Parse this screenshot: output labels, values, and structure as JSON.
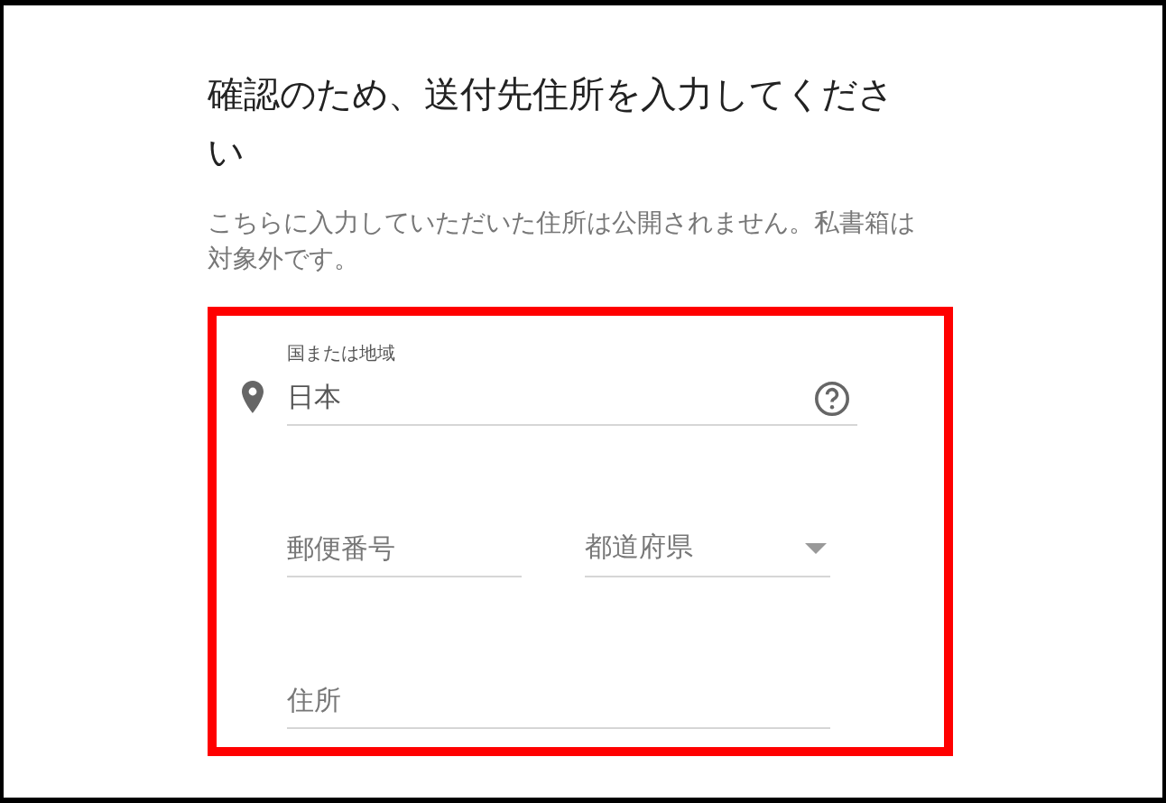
{
  "heading": "確認のため、送付先住所を入力してください",
  "note": "こちらに入力していただいた住所は公開されません。私書箱は対象外です。",
  "form": {
    "country": {
      "label": "国または地域",
      "value": "日本"
    },
    "postal_code": {
      "placeholder": "郵便番号"
    },
    "prefecture": {
      "placeholder": "都道府県"
    },
    "address": {
      "placeholder": "住所"
    }
  }
}
